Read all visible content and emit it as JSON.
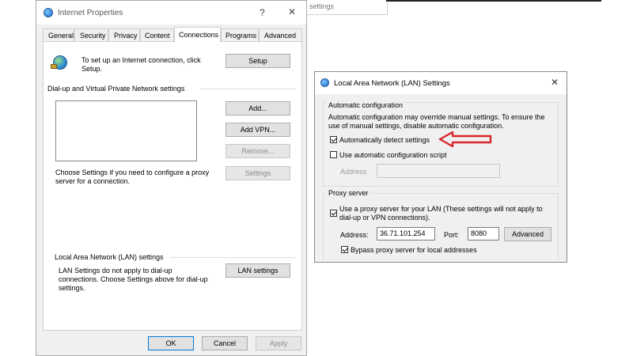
{
  "background_fragment": {
    "text": "settings"
  },
  "internet_properties": {
    "title": "Internet Properties",
    "help_glyph": "?",
    "close_glyph": "✕",
    "tabs": [
      "General",
      "Security",
      "Privacy",
      "Content",
      "Connections",
      "Programs",
      "Advanced"
    ],
    "active_tab": "Connections",
    "setup_text": "To set up an Internet connection, click Setup.",
    "setup_button": "Setup",
    "dialup_heading": "Dial-up and Virtual Private Network settings",
    "add_button": "Add...",
    "add_vpn_button": "Add VPN...",
    "remove_button": "Remove...",
    "settings_button": "Settings",
    "proxy_text": "Choose Settings if you need to configure a proxy server for a connection.",
    "lan_heading": "Local Area Network (LAN) settings",
    "lan_text": "LAN Settings do not apply to dial-up connections. Choose Settings above for dial-up settings.",
    "lan_settings_button": "LAN settings",
    "ok_button": "OK",
    "cancel_button": "Cancel",
    "apply_button": "Apply"
  },
  "lan_dialog": {
    "title": "Local Area Network (LAN) Settings",
    "close_glyph": "✕",
    "auto_config_heading": "Automatic configuration",
    "auto_config_text": "Automatic configuration may override manual settings.  To ensure the use of manual settings, disable automatic configuration.",
    "auto_detect_label": "Automatically detect settings",
    "auto_detect_checked": true,
    "auto_script_label": "Use automatic configuration script",
    "auto_script_checked": false,
    "address_label_disabled": "Address",
    "script_address_value": "",
    "proxy_heading": "Proxy server",
    "use_proxy_label": "Use a proxy server for your LAN (These settings will not apply to dial-up or VPN connections).",
    "use_proxy_checked": true,
    "address_label": "Address:",
    "address_value": "36.71.101.254",
    "port_label": "Port:",
    "port_value": "8080",
    "advanced_button": "Advanced",
    "bypass_label": "Bypass proxy server for local addresses",
    "bypass_checked": true
  },
  "annotation": {
    "arrow_color": "#d8262b"
  }
}
